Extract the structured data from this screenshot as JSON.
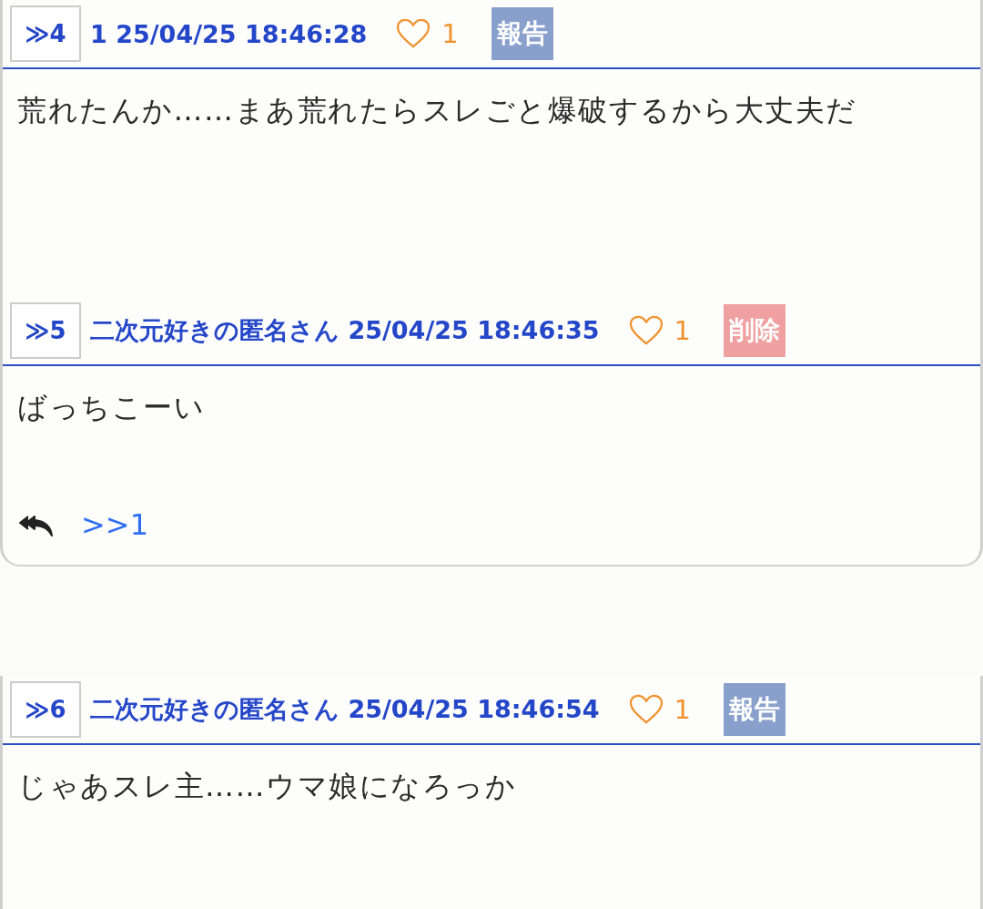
{
  "cards": [
    {
      "posts": [
        {
          "number": "≫4",
          "author": "1",
          "date": "25/04/25 18:46:28",
          "likes": "1",
          "action": {
            "kind": "report",
            "label": "報告"
          },
          "body": "荒れたんか……まあ荒れたらスレごと爆破するから大丈夫だ"
        },
        {
          "number": "≫5",
          "author": "二次元好きの匿名さん",
          "date": "25/04/25 18:46:35",
          "likes": "1",
          "action": {
            "kind": "delete",
            "label": "削除"
          },
          "body": "ばっちこーい",
          "replies": [
            ">>1"
          ]
        }
      ]
    },
    {
      "posts": [
        {
          "number": "≫6",
          "author": "二次元好きの匿名さん",
          "date": "25/04/25 18:46:54",
          "likes": "1",
          "action": {
            "kind": "report",
            "label": "報告"
          },
          "body": "じゃあスレ主……ウマ娘になろっか"
        }
      ]
    }
  ]
}
